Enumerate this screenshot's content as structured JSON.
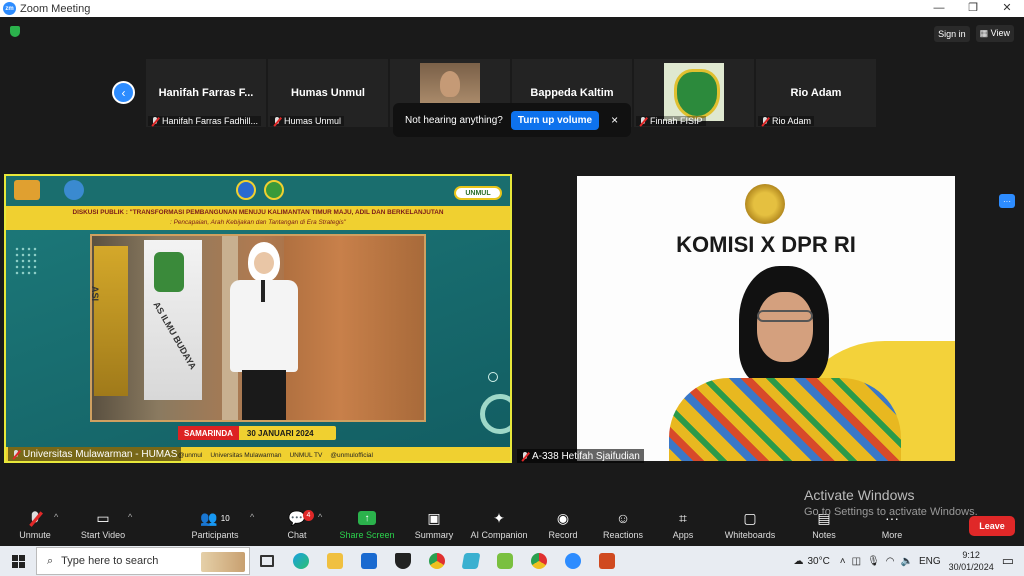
{
  "window": {
    "title": "Zoom Meeting",
    "controls": [
      "—",
      "❐",
      "✕"
    ]
  },
  "top_right": {
    "sign_in": "Sign in",
    "view": "View"
  },
  "gallery": {
    "tiles": [
      {
        "name": "Hanifah Farras F...",
        "label": "Hanifah Farras Fadhill..."
      },
      {
        "name": "Humas Unmul",
        "label": "Humas Unmul"
      },
      {
        "name": "",
        "label": ""
      },
      {
        "name": "Bappeda Kaltim",
        "label": ""
      },
      {
        "name": "",
        "label": "Finnah FISIP"
      },
      {
        "name": "Rio Adam",
        "label": "Rio Adam"
      }
    ]
  },
  "toast": {
    "text": "Not hearing anything?",
    "button": "Turn up volume",
    "close": "×"
  },
  "video_left": {
    "banner_title_line1": "DISKUSI PUBLIK : \"TRANSFORMASI PEMBANGUNAN MENUJU KALIMANTAN TIMUR MAJU, ADIL DAN BERKELANJUTAN",
    "banner_title_line2": ": Pencapaian, Arah Kebijakan dan Tantangan di Era Strategis\"",
    "pill": "UNMUL",
    "flag_text": "AS ILMU BUDAYA",
    "flag_text2": "ASI",
    "city": "SAMARINDA",
    "date": "30 JANUARI 2024",
    "participant": "Universitas Mulawarman - HUMAS",
    "socials": [
      "@unmul",
      "Universitas Mulawarman",
      "UNMUL TV",
      "@unmulofficial"
    ]
  },
  "video_right": {
    "title": "KOMISI X DPR RI",
    "participant": "A-338 Hetifah Sjaifudian",
    "more": "···"
  },
  "watermark": {
    "line1": "Activate Windows",
    "line2": "Go to Settings to activate Windows."
  },
  "toolbar": {
    "unmute": "Unmute",
    "start_video": "Start Video",
    "participants": "Participants",
    "participants_count": "10",
    "chat": "Chat",
    "chat_badge": "4",
    "share_screen": "Share Screen",
    "summary": "Summary",
    "ai_companion": "AI Companion",
    "record": "Record",
    "reactions": "Reactions",
    "apps": "Apps",
    "whiteboards": "Whiteboards",
    "notes": "Notes",
    "more": "More",
    "leave": "Leave"
  },
  "taskbar": {
    "search_placeholder": "Type here to search",
    "temperature": "30°C",
    "language": "ENG",
    "time": "9:12",
    "date": "30/01/2024"
  },
  "colors": {
    "accent": "#2d8cff",
    "leave": "#e02828",
    "share": "#2bb24c",
    "active_border": "#e8e83a"
  }
}
